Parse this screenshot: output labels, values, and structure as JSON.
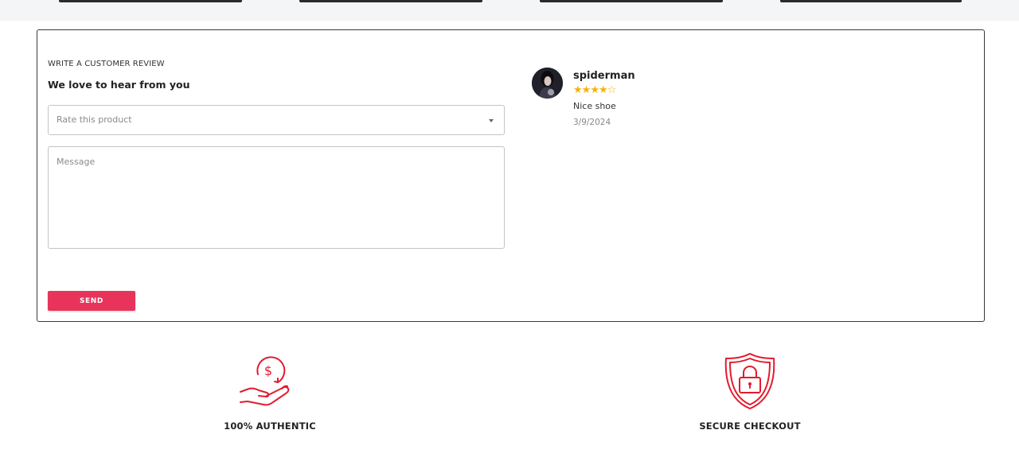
{
  "review_form": {
    "kicker": "WRITE A CUSTOMER REVIEW",
    "heading": "We love to hear from you",
    "rating_placeholder": "Rate this product",
    "message_placeholder": "Message",
    "send_label": "SEND"
  },
  "reviews": [
    {
      "name": "spiderman",
      "rating": 4,
      "max_rating": 5,
      "text": "Nice shoe",
      "date": "3/9/2024"
    }
  ],
  "features": [
    {
      "label": "100% AUTHENTIC",
      "icon": "money-hand-icon"
    },
    {
      "label": "SECURE CHECKOUT",
      "icon": "shield-lock-icon"
    }
  ],
  "colors": {
    "accent": "#e8345a",
    "star": "#f5b301",
    "icon_red": "#e31b2e"
  }
}
